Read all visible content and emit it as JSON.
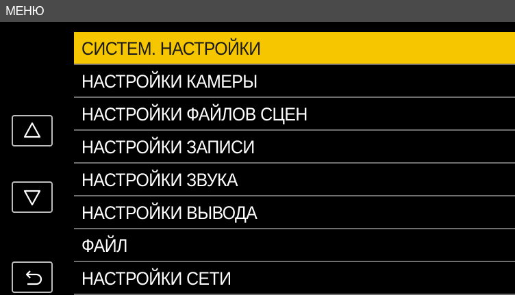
{
  "header": {
    "title": "МЕНЮ"
  },
  "colors": {
    "background": "#000000",
    "header_bg": "#4a4a4a",
    "selected_bg": "#f6c600",
    "divider": "#6e6e6e",
    "button_border": "#bdbdbd"
  },
  "side_buttons": {
    "up_icon": "triangle-up-icon",
    "down_icon": "triangle-down-icon",
    "back_icon": "return-arrow-icon"
  },
  "menu": {
    "selected_index": 0,
    "items": [
      {
        "label": "СИСТЕМ. НАСТРОЙКИ"
      },
      {
        "label": "НАСТРОЙКИ КАМЕРЫ"
      },
      {
        "label": "НАСТРОЙКИ ФАЙЛОВ СЦЕН"
      },
      {
        "label": "НАСТРОЙКИ ЗАПИСИ"
      },
      {
        "label": "НАСТРОЙКИ ЗВУКА"
      },
      {
        "label": "НАСТРОЙКИ ВЫВОДА"
      },
      {
        "label": "ФАЙЛ"
      },
      {
        "label": "НАСТРОЙКИ СЕТИ"
      }
    ]
  }
}
